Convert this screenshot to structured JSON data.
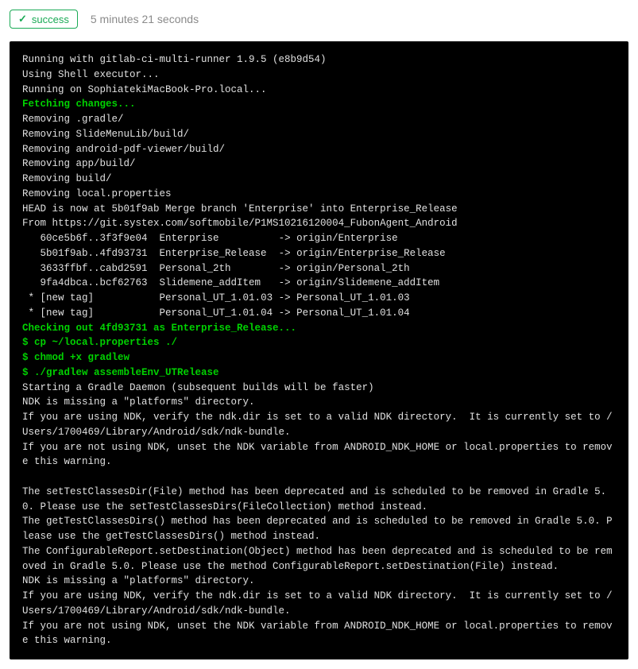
{
  "header": {
    "status_label": "success",
    "duration": "5 minutes 21 seconds"
  },
  "terminal": {
    "lines": [
      {
        "cls": "white",
        "text": "Running with gitlab-ci-multi-runner 1.9.5 (e8b9d54)"
      },
      {
        "cls": "white",
        "text": "Using Shell executor..."
      },
      {
        "cls": "white",
        "text": "Running on SophiatekiMacBook-Pro.local..."
      },
      {
        "cls": "green",
        "text": "Fetching changes..."
      },
      {
        "cls": "white",
        "text": "Removing .gradle/"
      },
      {
        "cls": "white",
        "text": "Removing SlideMenuLib/build/"
      },
      {
        "cls": "white",
        "text": "Removing android-pdf-viewer/build/"
      },
      {
        "cls": "white",
        "text": "Removing app/build/"
      },
      {
        "cls": "white",
        "text": "Removing build/"
      },
      {
        "cls": "white",
        "text": "Removing local.properties"
      },
      {
        "cls": "white",
        "text": "HEAD is now at 5b01f9ab Merge branch 'Enterprise' into Enterprise_Release"
      },
      {
        "cls": "white",
        "text": "From https://git.systex.com/softmobile/P1MS10216120004_FubonAgent_Android"
      },
      {
        "cls": "white",
        "text": "   60ce5b6f..3f3f9e04  Enterprise          -> origin/Enterprise"
      },
      {
        "cls": "white",
        "text": "   5b01f9ab..4fd93731  Enterprise_Release  -> origin/Enterprise_Release"
      },
      {
        "cls": "white",
        "text": "   3633ffbf..cabd2591  Personal_2th        -> origin/Personal_2th"
      },
      {
        "cls": "white",
        "text": "   9fa4dbca..bcf62763  Slidemene_addItem   -> origin/Slidemene_addItem"
      },
      {
        "cls": "white",
        "text": " * [new tag]           Personal_UT_1.01.03 -> Personal_UT_1.01.03"
      },
      {
        "cls": "white",
        "text": " * [new tag]           Personal_UT_1.01.04 -> Personal_UT_1.01.04"
      },
      {
        "cls": "green",
        "text": "Checking out 4fd93731 as Enterprise_Release..."
      },
      {
        "cls": "green",
        "text": "$ cp ~/local.properties ./"
      },
      {
        "cls": "green",
        "text": "$ chmod +x gradlew"
      },
      {
        "cls": "green",
        "text": "$ ./gradlew assembleEnv_UTRelease"
      },
      {
        "cls": "white",
        "text": "Starting a Gradle Daemon (subsequent builds will be faster)"
      },
      {
        "cls": "white",
        "text": "NDK is missing a \"platforms\" directory."
      },
      {
        "cls": "white",
        "text": "If you are using NDK, verify the ndk.dir is set to a valid NDK directory.  It is currently set to /Users/1700469/Library/Android/sdk/ndk-bundle."
      },
      {
        "cls": "white",
        "text": "If you are not using NDK, unset the NDK variable from ANDROID_NDK_HOME or local.properties to remove this warning."
      },
      {
        "cls": "white",
        "text": " "
      },
      {
        "cls": "white",
        "text": "The setTestClassesDir(File) method has been deprecated and is scheduled to be removed in Gradle 5.0. Please use the setTestClassesDirs(FileCollection) method instead."
      },
      {
        "cls": "white",
        "text": "The getTestClassesDirs() method has been deprecated and is scheduled to be removed in Gradle 5.0. Please use the getTestClassesDirs() method instead."
      },
      {
        "cls": "white",
        "text": "The ConfigurableReport.setDestination(Object) method has been deprecated and is scheduled to be removed in Gradle 5.0. Please use the method ConfigurableReport.setDestination(File) instead."
      },
      {
        "cls": "white",
        "text": "NDK is missing a \"platforms\" directory."
      },
      {
        "cls": "white",
        "text": "If you are using NDK, verify the ndk.dir is set to a valid NDK directory.  It is currently set to /Users/1700469/Library/Android/sdk/ndk-bundle."
      },
      {
        "cls": "white",
        "text": "If you are not using NDK, unset the NDK variable from ANDROID_NDK_HOME or local.properties to remove this warning."
      }
    ]
  }
}
